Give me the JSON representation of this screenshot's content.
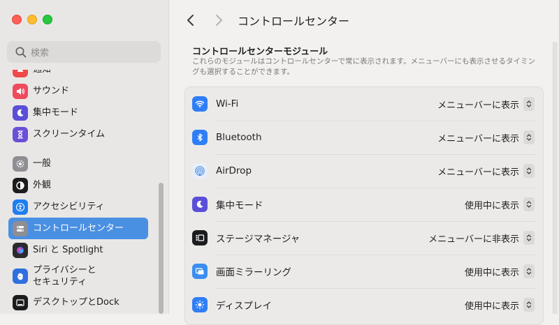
{
  "window": {
    "title": "コントロールセンター"
  },
  "search": {
    "placeholder": "検索"
  },
  "sidebar": {
    "items": [
      {
        "label": "通知",
        "icon": "bell-icon",
        "color": "#ef4a4a"
      },
      {
        "label": "サウンド",
        "icon": "speaker-icon",
        "color": "#ef4a5e"
      },
      {
        "label": "集中モード",
        "icon": "moon-icon",
        "color": "#5a4fd6"
      },
      {
        "label": "スクリーンタイム",
        "icon": "hourglass-icon",
        "color": "#6b4fd6"
      },
      {
        "label": "一般",
        "icon": "gear-icon",
        "color": "#8e8e93"
      },
      {
        "label": "外観",
        "icon": "appearance-icon",
        "color": "#1c1c1e"
      },
      {
        "label": "アクセシビリティ",
        "icon": "accessibility-icon",
        "color": "#1f7ef0"
      },
      {
        "label": "コントロールセンター",
        "icon": "control-center-icon",
        "color": "#8e8e93",
        "selected": true
      },
      {
        "label": "Siri と Spotlight",
        "icon": "siri-icon",
        "color": "#2b2b2b"
      },
      {
        "label": "プライバシーと\nセキュリティ",
        "icon": "hand-icon",
        "color": "#2f6fe0"
      },
      {
        "label": "デスクトップとDock",
        "icon": "dock-icon",
        "color": "#1c1c1e"
      }
    ]
  },
  "main": {
    "section_title": "コントロールセンターモジュール",
    "section_desc": "これらのモジュールはコントロールセンターで常に表示されます。メニューバーにも表示させるタイミングも選択することができます。",
    "rows": [
      {
        "label": "Wi-Fi",
        "value": "メニューバーに表示",
        "icon": "wifi-icon",
        "color": "#2f7ef5"
      },
      {
        "label": "Bluetooth",
        "value": "メニューバーに表示",
        "icon": "bluetooth-icon",
        "color": "#2f7ef5"
      },
      {
        "label": "AirDrop",
        "value": "メニューバーに表示",
        "icon": "airdrop-icon",
        "color": "#e9eef7"
      },
      {
        "label": "集中モード",
        "value": "使用中に表示",
        "icon": "moon-icon",
        "color": "#5a4fd6"
      },
      {
        "label": "ステージマネージャ",
        "value": "メニューバーに非表示",
        "icon": "stage-manager-icon",
        "color": "#1c1c1e"
      },
      {
        "label": "画面ミラーリング",
        "value": "使用中に表示",
        "icon": "screen-mirroring-icon",
        "color": "#3b8ef0"
      },
      {
        "label": "ディスプレイ",
        "value": "使用中に表示",
        "icon": "display-brightness-icon",
        "color": "#2f7ef5"
      }
    ]
  }
}
